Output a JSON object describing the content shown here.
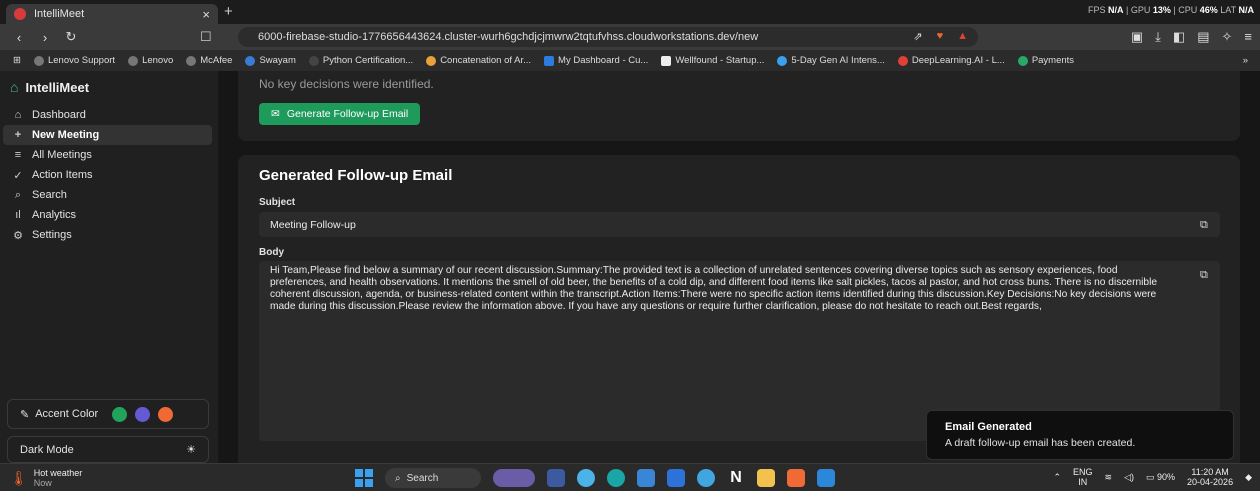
{
  "browser": {
    "tab_title": "IntelliMeet",
    "tab_close": "×",
    "new_tab": "+",
    "perf": {
      "fps_label": "FPS",
      "fps": "N/A",
      "gpu_label": "GPU",
      "gpu": "13%",
      "cpu_label": "CPU",
      "cpu": "46%",
      "lat_label": "LAT",
      "lat": "N/A"
    },
    "url": "6000-firebase-studio-1776656443624.cluster-wurh6gchdjcjmwrw2tqtufvhss.cloudworkstations.dev/new",
    "bookmarks": [
      "Lenovo Support",
      "Lenovo",
      "McAfee",
      "Swayam",
      "Python Certification...",
      "Concatenation of Ar...",
      "My Dashboard - Cu...",
      "Wellfound - Startup...",
      "5-Day Gen AI Intens...",
      "DeepLearning.AI - L...",
      "Payments"
    ],
    "bookmarks_more": "»"
  },
  "sidebar": {
    "app_name": "IntelliMeet",
    "items": [
      {
        "label": "Dashboard",
        "icon": "home-icon",
        "glyph": "⌂"
      },
      {
        "label": "New Meeting",
        "icon": "plus-icon",
        "glyph": "+"
      },
      {
        "label": "All Meetings",
        "icon": "list-icon",
        "glyph": "≡"
      },
      {
        "label": "Action Items",
        "icon": "check-icon",
        "glyph": "✓"
      },
      {
        "label": "Search",
        "icon": "search-icon",
        "glyph": "⌕"
      },
      {
        "label": "Analytics",
        "icon": "bar-chart-icon",
        "glyph": "ıl"
      },
      {
        "label": "Settings",
        "icon": "gear-icon",
        "glyph": "⚙"
      }
    ],
    "active_index": 1,
    "accent_label": "Accent Color",
    "accent_colors": [
      "#22a35b",
      "#6659d6",
      "#f06a35"
    ],
    "dark_mode_label": "Dark Mode",
    "dark_mode_icon": "☀"
  },
  "main": {
    "decisions_text": "No key decisions were identified.",
    "generate_button": "Generate Follow-up Email",
    "email_title": "Generated Follow-up Email",
    "subject_label": "Subject",
    "subject_value": "Meeting Follow-up",
    "body_label": "Body",
    "body_value": "Hi Team,Please find below a summary of our recent discussion.Summary:The provided text is a collection of unrelated sentences covering diverse topics such as sensory experiences, food preferences, and health observations. It mentions the smell of old beer, the benefits of a cold dip, and different food items like salt pickles, tacos al pastor, and hot cross buns. There is no discernible coherent discussion, agenda, or business-related content within the transcript.Action Items:There were no specific action items identified during this discussion.Key Decisions:No key decisions were made during this discussion.Please review the information above. If you have any questions or require further clarification, please do not hesitate to reach out.Best regards,"
  },
  "toast": {
    "title": "Email Generated",
    "message": "A draft follow-up email has been created."
  },
  "taskbar": {
    "weather_title": "Hot weather",
    "weather_sub": "Now",
    "search_label": "Search",
    "lang_top": "ENG",
    "lang_bottom": "IN",
    "battery": "90%",
    "time": "11:20 AM",
    "date": "20-04-2026"
  }
}
